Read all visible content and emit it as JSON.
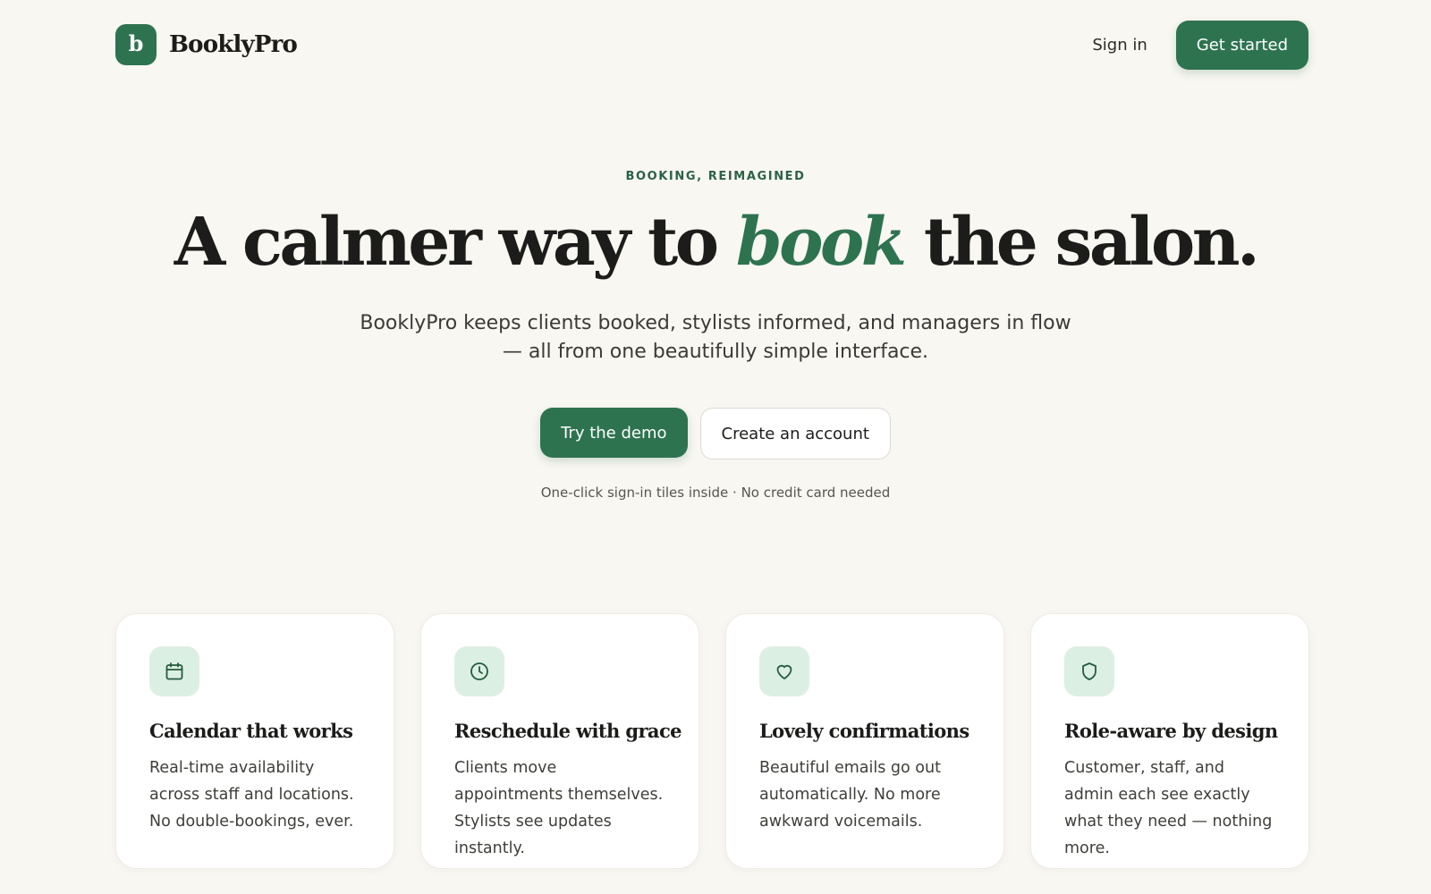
{
  "header": {
    "logo_letter": "b",
    "brand_name": "BooklyPro",
    "signin_label": "Sign in",
    "get_started_label": "Get started"
  },
  "hero": {
    "eyebrow": "BOOKING, REIMAGINED",
    "headline_before": "A calmer way to ",
    "headline_accent": "book",
    "headline_after": " the salon.",
    "subhead": "BooklyPro keeps clients booked, stylists informed, and managers in flow — all from one beautifully simple interface.",
    "primary_cta": "Try the demo",
    "secondary_cta": "Create an account",
    "note": "One-click sign-in tiles inside · No credit card needed"
  },
  "features": [
    {
      "icon": "calendar-icon",
      "title": "Calendar that works",
      "body": "Real-time availability across staff and locations. No double-bookings, ever."
    },
    {
      "icon": "clock-icon",
      "title": "Reschedule with grace",
      "body": "Clients move appointments themselves. Stylists see updates instantly."
    },
    {
      "icon": "heart-icon",
      "title": "Lovely confirmations",
      "body": "Beautiful emails go out automatically. No more awkward voicemails."
    },
    {
      "icon": "shield-icon",
      "title": "Role-aware by design",
      "body": "Customer, staff, and admin each see exactly what they need — nothing more."
    }
  ],
  "colors": {
    "brand_green": "#2e7350",
    "background": "#f9f7f2",
    "icon_tile": "#dcefe3"
  }
}
